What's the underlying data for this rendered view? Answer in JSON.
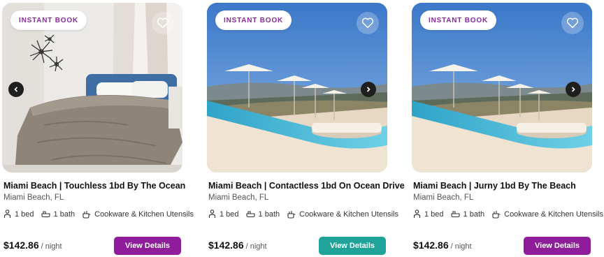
{
  "colors": {
    "badge_text": "#8a2aa0",
    "button_purple": "#8f1d9b",
    "button_teal": "#1fa398"
  },
  "listings": [
    {
      "badge": "INSTANT BOOK",
      "title": "Miami Beach | Touchless 1bd By The Ocean",
      "location": "Miami Beach, FL",
      "beds": "1 bed",
      "baths": "1 bath",
      "amenity": "Cookware & Kitchen Utensils",
      "price": "$142.86",
      "per": "/ night",
      "cta": "View Details",
      "cta_color": "#8f1d9b"
    },
    {
      "badge": "INSTANT BOOK",
      "title": "Miami Beach | Contactless 1bd On Ocean Drive",
      "location": "Miami Beach, FL",
      "beds": "1 bed",
      "baths": "1 bath",
      "amenity": "Cookware & Kitchen Utensils",
      "price": "$142.86",
      "per": "/ night",
      "cta": "View Details",
      "cta_color": "#1fa398"
    },
    {
      "badge": "INSTANT BOOK",
      "title": "Miami Beach | Jurny 1bd By The Beach",
      "location": "Miami Beach, FL",
      "beds": "1 bed",
      "baths": "1 bath",
      "amenity": "Cookware & Kitchen Utensils",
      "price": "$142.86",
      "per": "/ night",
      "cta": "View Details",
      "cta_color": "#8f1d9b"
    }
  ]
}
